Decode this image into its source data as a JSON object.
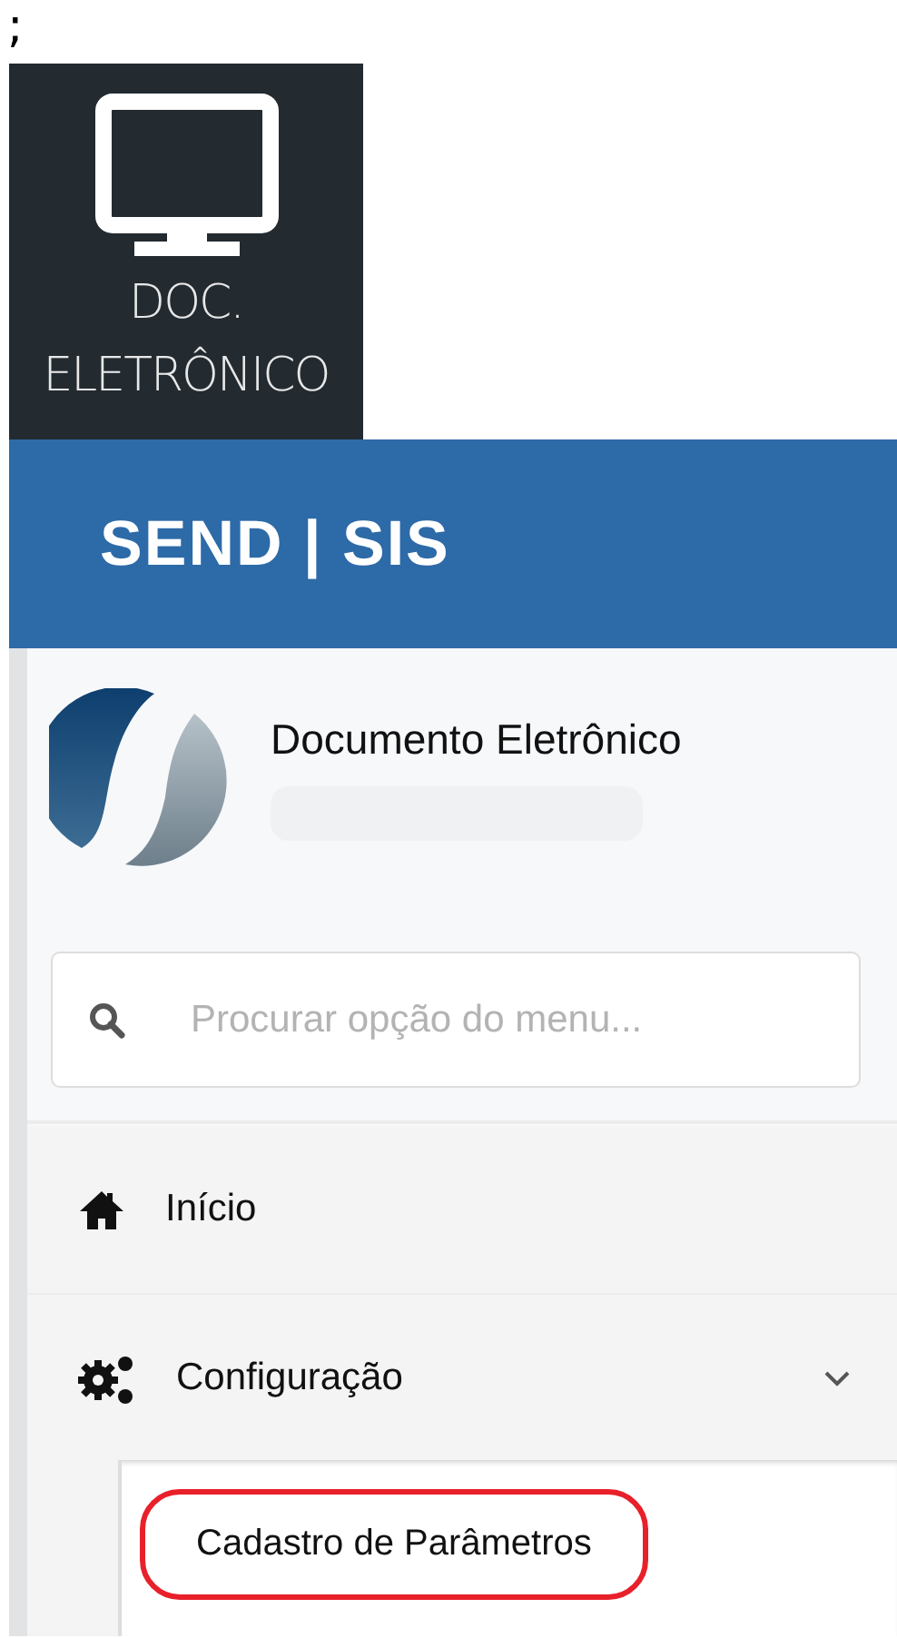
{
  "top_text": ";",
  "app_tile": {
    "label": "DOC. ELETRÔNICO"
  },
  "header": {
    "brand": "SEND | SIS"
  },
  "profile": {
    "title": "Documento Eletrônico"
  },
  "search": {
    "placeholder": "Procurar opção do menu..."
  },
  "menu": [
    {
      "kind": "home",
      "label": "Início"
    },
    {
      "kind": "gears",
      "label": "Configuração",
      "expanded": true,
      "children": [
        {
          "label": "Cadastro de Parâmetros",
          "highlighted": true
        }
      ]
    }
  ]
}
